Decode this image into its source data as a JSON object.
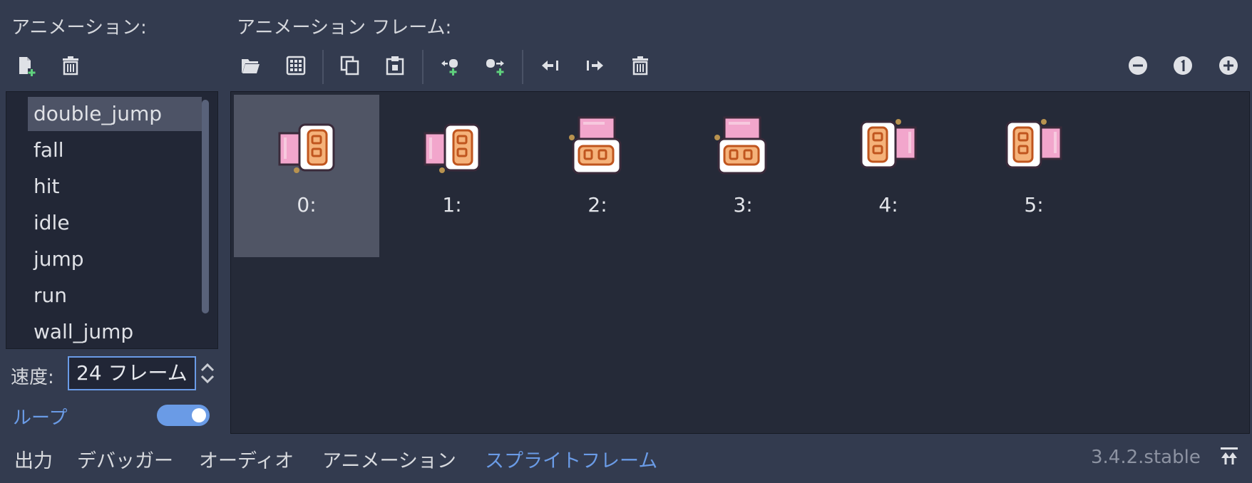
{
  "animations_panel": {
    "title": "アニメーション:",
    "items": [
      "double_jump",
      "fall",
      "hit",
      "idle",
      "jump",
      "run",
      "wall_jump"
    ],
    "selected": "double_jump",
    "speed_label": "速度:",
    "speed_value": "24 フレーム",
    "loop_label": "ループ",
    "loop_enabled": true
  },
  "frames_panel": {
    "title": "アニメーション フレーム:",
    "frames": [
      "0:",
      "1:",
      "2:",
      "3:",
      "4:",
      "5:"
    ],
    "selected_index": 0
  },
  "toolbar_icons": {
    "new_animation": "new-animation-icon",
    "delete_animation": "delete-animation-icon",
    "load": "folder-open-icon",
    "spritesheet": "grid-icon",
    "copy": "copy-icon",
    "paste": "paste-icon",
    "insert_before": "insert-before-icon",
    "insert_after": "insert-after-icon",
    "move_left": "move-left-icon",
    "move_right": "move-right-icon",
    "delete_frame": "delete-frame-icon",
    "zoom_out": "zoom-out-icon",
    "zoom_reset": "zoom-reset-icon",
    "zoom_in": "zoom-in-icon"
  },
  "bottom_tabs": [
    "出力",
    "デバッガー",
    "オーディオ",
    "アニメーション",
    "スプライトフレーム"
  ],
  "active_tab": "スプライトフレーム",
  "version": "3.4.2.stable",
  "colors": {
    "background": "#333b4f",
    "panel": "#222736",
    "accent": "#6a9be6",
    "selected": "#4d5366"
  }
}
